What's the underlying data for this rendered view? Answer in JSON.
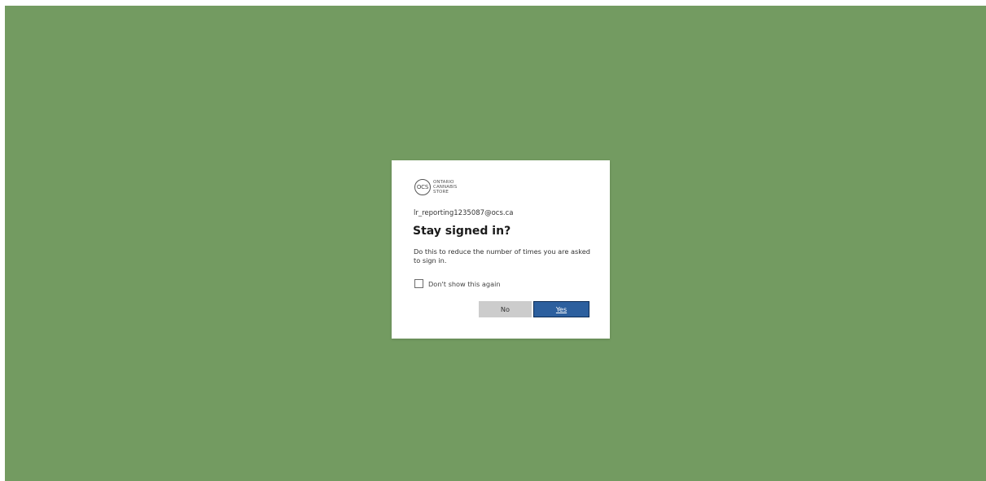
{
  "page": {
    "background_color": "#739b61"
  },
  "dialog": {
    "logo": {
      "circle_text": "OCS",
      "line1": "ONTARIO",
      "line2": "CANNABIS",
      "line3": "STORE"
    },
    "email": "lr_reporting1235087@ocs.ca",
    "title": "Stay signed in?",
    "description": "Do this to reduce the number of times you are asked to sign in.",
    "checkbox": {
      "label": "Don't show this again",
      "checked": false
    },
    "buttons": {
      "no_label": "No",
      "yes_label": "Yes",
      "primary_color": "#2c5f9e"
    }
  }
}
